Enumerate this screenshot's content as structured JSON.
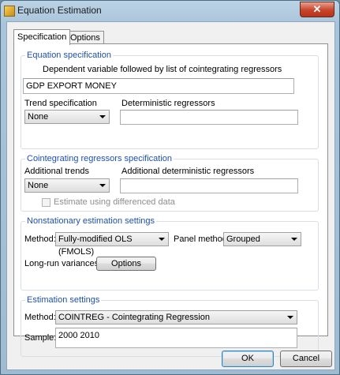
{
  "window": {
    "title": "Equation Estimation",
    "close_glyph": "✕"
  },
  "tabs": [
    {
      "label": "Specification",
      "active": true
    },
    {
      "label": "Options",
      "active": false
    }
  ],
  "equation_spec": {
    "legend": "Equation specification",
    "description": "Dependent variable followed by list of cointegrating regressors",
    "value": "GDP EXPORT MONEY",
    "trend_label": "Trend specification",
    "trend_value": "None",
    "deterministic_label": "Deterministic regressors",
    "deterministic_value": ""
  },
  "cointegrating_spec": {
    "legend": "Cointegrating regressors specification",
    "additional_trends_label": "Additional trends",
    "additional_trends_value": "None",
    "additional_deterministic_label": "Additional deterministic regressors",
    "additional_deterministic_value": "",
    "differenced_label": "Estimate using differenced data",
    "differenced_checked": false
  },
  "nonstationary": {
    "legend": "Nonstationary estimation settings",
    "method_label": "Method:",
    "method_value": "Fully-modified OLS (FMOLS)",
    "panel_label": "Panel method:",
    "panel_value": "Grouped",
    "longrun_label": "Long-run variances:",
    "options_button": "Options"
  },
  "estimation": {
    "legend": "Estimation settings",
    "method_label": "Method:",
    "method_value": "COINTREG  -  Cointegrating Regression",
    "sample_label": "Sample:",
    "sample_value": "2000 2010"
  },
  "buttons": {
    "ok": "OK",
    "cancel": "Cancel"
  }
}
